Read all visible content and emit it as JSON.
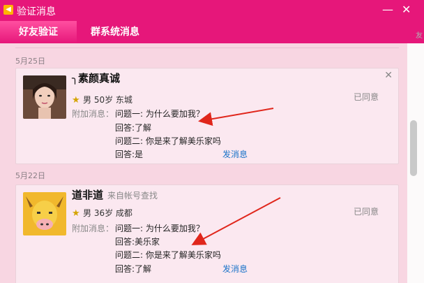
{
  "window": {
    "title": "验证消息",
    "minimize_glyph": "—",
    "close_glyph": "✕"
  },
  "tabs": [
    {
      "label": "好友验证"
    },
    {
      "label": "群系统消息"
    }
  ],
  "side_fragment": "友",
  "messages": [
    {
      "date": "5月25日",
      "name": "╮素颜真诚",
      "meta": "男 50岁 东城",
      "extra_label": "附加消息：",
      "lines": [
        "问题一: 为什么要加我？",
        "回答:了解",
        "问题二: 你是来了解美乐家吗",
        "回答:是"
      ],
      "status": "已同意",
      "send_label": "发消息",
      "close_glyph": "✕"
    },
    {
      "date": "5月22日",
      "name": "道非道",
      "source": "来自帐号查找",
      "meta": "男 36岁 成都",
      "extra_label": "附加消息：",
      "lines": [
        "问题一: 为什么要加我？",
        "回答:美乐家",
        "问题二: 你是来了解美乐家吗",
        "回答:了解"
      ],
      "status": "已同意",
      "send_label": "发消息"
    }
  ],
  "colors": {
    "accent": "#e6177a",
    "link": "#1a73c9",
    "arrow": "#e0261b"
  }
}
